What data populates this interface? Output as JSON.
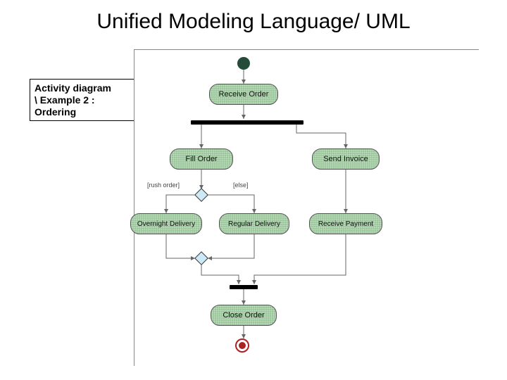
{
  "title": "Unified Modeling Language/ UML",
  "caption": {
    "line1": "Activity diagram",
    "line2": "\\ Example 2 :",
    "line3": "Ordering"
  },
  "activities": {
    "receive_order": "Receive Order",
    "fill_order": "Fill Order",
    "send_invoice": "Send Invoice",
    "overnight_delivery": "Overnight Delivery",
    "regular_delivery": "Regular Delivery",
    "receive_payment": "Receive Payment",
    "close_order": "Close Order"
  },
  "guards": {
    "rush": "[rush order]",
    "else": "[else]"
  }
}
